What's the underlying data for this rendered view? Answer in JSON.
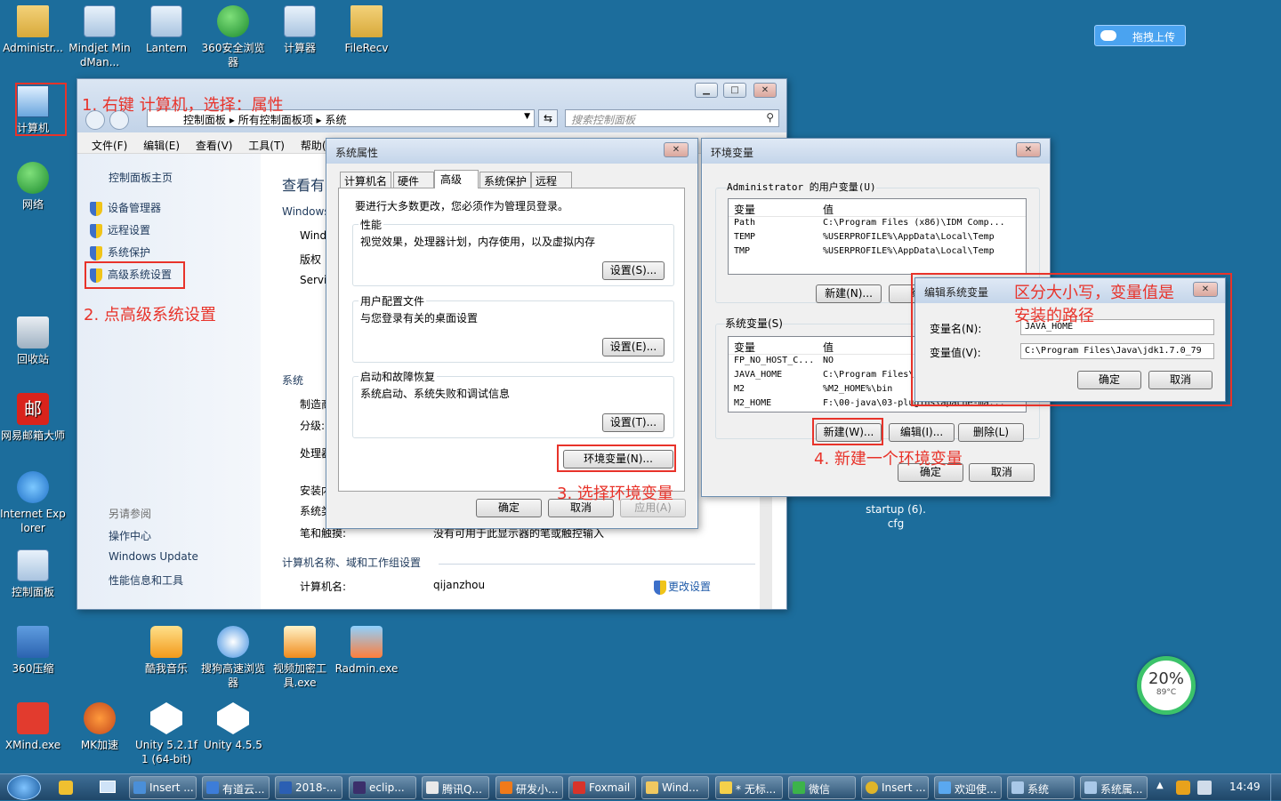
{
  "desktop": {
    "icons": [
      {
        "label": "Administr..."
      },
      {
        "label": "Mindjet MindMan..."
      },
      {
        "label": "Lantern"
      },
      {
        "label": "360安全浏览器"
      },
      {
        "label": "计算器"
      },
      {
        "label": "FileRecv"
      },
      {
        "label": "计算机"
      },
      {
        "label": "网络"
      },
      {
        "label": "回收站"
      },
      {
        "label": "网易邮箱大师"
      },
      {
        "label": "Internet Explorer"
      },
      {
        "label": "控制面板"
      },
      {
        "label": "360压缩"
      },
      {
        "label": "XMind.exe"
      },
      {
        "label": "MK加速"
      },
      {
        "label": "Unity 5.2.1f1 (64-bit)"
      },
      {
        "label": "Unity 4.5.5"
      },
      {
        "label": "酷我音乐"
      },
      {
        "label": "搜狗高速浏览器"
      },
      {
        "label": "视频加密工具.exe"
      },
      {
        "label": "Radmin.exe"
      }
    ],
    "mail_icon_glyph": "邮",
    "startup_label": "startup (6).cfg",
    "upload_button": "拖拽上传",
    "gauge": {
      "percent": "20%",
      "temp": "89°C"
    }
  },
  "control_panel": {
    "breadcrumb": [
      "控制面板",
      "所有控制面板项",
      "系统"
    ],
    "search_placeholder": "搜索控制面板",
    "menu": [
      "文件(F)",
      "编辑(E)",
      "查看(V)",
      "工具(T)",
      "帮助(H)"
    ],
    "left_home": "控制面板主页",
    "left_links": [
      "设备管理器",
      "远程设置",
      "系统保护",
      "高级系统设置"
    ],
    "see_also_title": "另请参阅",
    "see_also": [
      "操作中心",
      "Windows Update",
      "性能信息和工具"
    ],
    "heading": "查看有",
    "windows_edition": "Windows",
    "edition_items": [
      "Wind",
      "版权",
      "Servi"
    ],
    "system_title": "系统",
    "system_items": [
      "制造商",
      "分级:",
      "处理器",
      "安装内",
      "系统类",
      "笔和触摸:"
    ],
    "pen_touch_value": "没有可用于此显示器的笔或触控输入",
    "network_title": "计算机名称、域和工作组设置",
    "computer_name_label": "计算机名:",
    "computer_name_value": "qijanzhou",
    "change_settings": "更改设置"
  },
  "sys_props": {
    "title": "系统属性",
    "tabs": [
      "计算机名",
      "硬件",
      "高级",
      "系统保护",
      "远程"
    ],
    "admin_note": "要进行大多数更改，您必须作为管理员登录。",
    "perf_title": "性能",
    "perf_desc": "视觉效果，处理器计划，内存使用，以及虚拟内存",
    "perf_btn": "设置(S)...",
    "profile_title": "用户配置文件",
    "profile_desc": "与您登录有关的桌面设置",
    "profile_btn": "设置(E)...",
    "startup_title": "启动和故障恢复",
    "startup_desc": "系统启动、系统失败和调试信息",
    "startup_btn": "设置(T)...",
    "env_btn": "环境变量(N)...",
    "ok": "确定",
    "cancel": "取消",
    "apply": "应用(A)"
  },
  "env_vars": {
    "title": "环境变量",
    "user_section": "Administrator 的用户变量(U)",
    "col_var": "变量",
    "col_val": "值",
    "user_vars": [
      {
        "name": "Path",
        "value": "C:\\Program Files (x86)\\IDM Comp..."
      },
      {
        "name": "TEMP",
        "value": "%USERPROFILE%\\AppData\\Local\\Temp"
      },
      {
        "name": "TMP",
        "value": "%USERPROFILE%\\AppData\\Local\\Temp"
      }
    ],
    "user_new": "新建(N)...",
    "user_edit": "编辑",
    "sys_section": "系统变量(S)",
    "sys_vars": [
      {
        "name": "FP_NO_HOST_C...",
        "value": "NO"
      },
      {
        "name": "JAVA_HOME",
        "value": "C:\\Program Files\\"
      },
      {
        "name": "M2",
        "value": "%M2_HOME%\\bin"
      },
      {
        "name": "M2_HOME",
        "value": "F:\\00-java\\03-plugins\\apache-ma..."
      }
    ],
    "sys_new": "新建(W)...",
    "sys_edit": "编辑(I)...",
    "sys_delete": "删除(L)",
    "ok": "确定",
    "cancel": "取消"
  },
  "edit_var": {
    "title": "编辑系统变量",
    "name_label": "变量名(N):",
    "name_value": "JAVA_HOME",
    "value_label": "变量值(V):",
    "value_value": "C:\\Program Files\\Java\\jdk1.7.0_79",
    "ok": "确定",
    "cancel": "取消"
  },
  "annotations": {
    "step1": "1. 右键 计算机，选择：属性",
    "step2": "2. 点高级系统设置",
    "step3": "3. 选择环境变量",
    "step4": "4. 新建一个环境变量",
    "note_line1": "区分大小写，变量值是",
    "note_line2": "安装的路径"
  },
  "taskbar": {
    "items": [
      "Insert ...",
      "有道云...",
      "2018-...",
      "eclip...",
      "腾讯Q...",
      "研发小...",
      "Foxmail",
      "Wind...",
      "* 无标...",
      "微信",
      "Insert ...",
      "欢迎使...",
      "系统",
      "系统属..."
    ],
    "clock": "14:49"
  },
  "colors": {
    "annotation": "#e8332a",
    "desktop": "#1c6d9c",
    "link": "#1e395b"
  }
}
